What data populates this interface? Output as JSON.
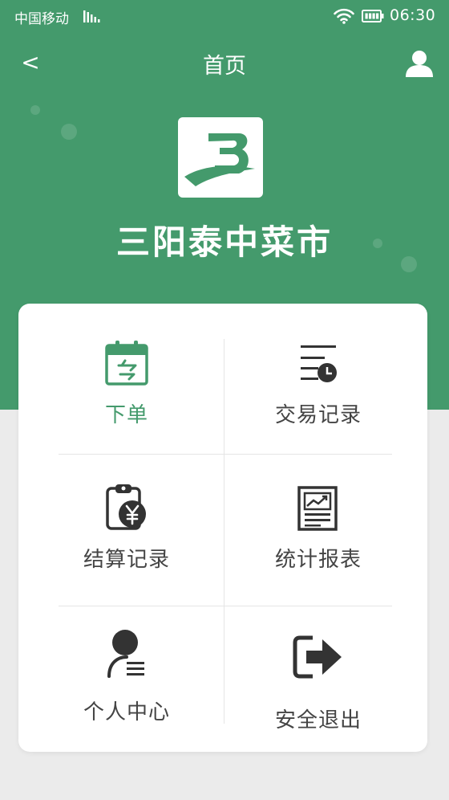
{
  "status_bar": {
    "carrier": "中国移动",
    "time": "06:30",
    "icons": [
      "signal-icon",
      "wifi-icon",
      "battery-icon"
    ]
  },
  "nav": {
    "title": "首页",
    "back_label": "<",
    "right_icon": "user-icon"
  },
  "brand": {
    "name": "三阳泰中菜市",
    "logo_icon": "brand-logo-b",
    "color": "#449a6c"
  },
  "menu": {
    "items": [
      {
        "label": "下单",
        "icon": "calendar-icon",
        "active": true
      },
      {
        "label": "交易记录",
        "icon": "list-clock-icon",
        "active": false
      },
      {
        "label": "结算记录",
        "icon": "clipboard-yen-icon",
        "active": false
      },
      {
        "label": "统计报表",
        "icon": "report-chart-icon",
        "active": false
      },
      {
        "label": "个人中心",
        "icon": "person-list-icon",
        "active": false
      },
      {
        "label": "安全退出",
        "icon": "logout-icon",
        "active": false
      }
    ]
  },
  "colors": {
    "primary": "#449a6c",
    "icon_dark": "#333333",
    "background": "#ebebeb"
  }
}
